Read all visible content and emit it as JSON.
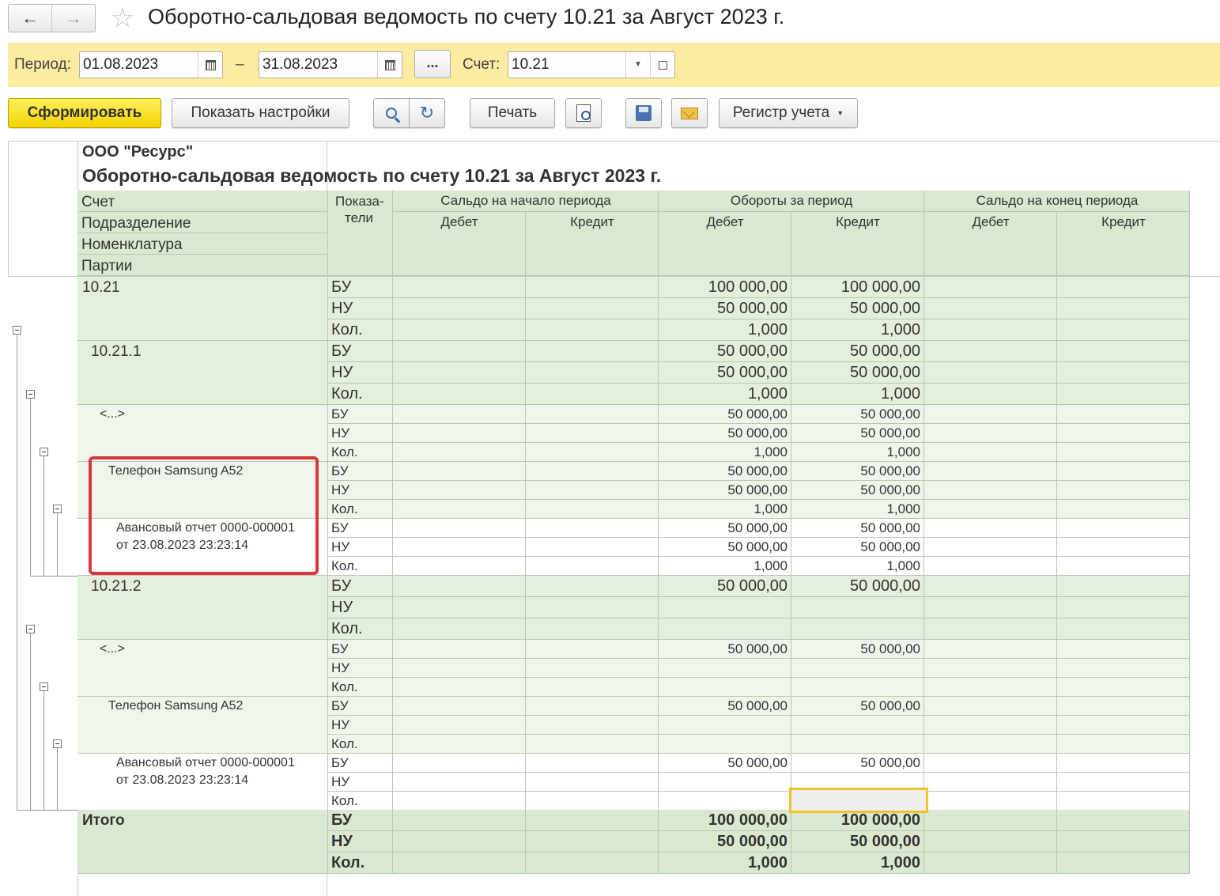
{
  "window": {
    "back_icon": "arrow-left-icon",
    "forward_icon": "arrow-right-icon",
    "favorite_icon": "star-icon",
    "title": "Оборотно-сальдовая ведомость по счету 10.21 за Август 2023 г."
  },
  "params": {
    "period_label": "Период:",
    "date_from": "01.08.2023",
    "dash": "–",
    "date_to": "31.08.2023",
    "more_label": "...",
    "account_label": "Счет:",
    "account_value": "10.21"
  },
  "toolbar": {
    "generate": "Сформировать",
    "settings": "Показать настройки",
    "print": "Печать",
    "register": "Регистр учета"
  },
  "report": {
    "org": "ООО \"Ресурс\"",
    "title": "Оборотно-сальдовая ведомость по счету 10.21 за Август 2023 г.",
    "row_headers": [
      "Счет",
      "Подразделение",
      "Номенклатура",
      "Партии"
    ],
    "indicators_header_1": "Показа-",
    "indicators_header_2": "тели",
    "groups": [
      "Сальдо на начало периода",
      "Обороты за период",
      "Сальдо на конец периода"
    ],
    "subcols": [
      "Дебет",
      "Кредит",
      "Дебет",
      "Кредит",
      "Дебет",
      "Кредит"
    ],
    "indicators": [
      "БУ",
      "НУ",
      "Кол."
    ],
    "blocks": [
      {
        "label": [
          "10.21"
        ],
        "values": [
          [
            "100 000,00",
            "100 000,00"
          ],
          [
            "50 000,00",
            "50 000,00"
          ],
          [
            "1,000",
            "1,000"
          ]
        ]
      },
      {
        "label": [
          "10.21.1"
        ],
        "values": [
          [
            "50 000,00",
            "50 000,00"
          ],
          [
            "50 000,00",
            "50 000,00"
          ],
          [
            "1,000",
            "1,000"
          ]
        ]
      },
      {
        "label": [
          "<...>"
        ],
        "values": [
          [
            "50 000,00",
            "50 000,00"
          ],
          [
            "50 000,00",
            "50 000,00"
          ],
          [
            "1,000",
            "1,000"
          ]
        ]
      },
      {
        "label": [
          "Телефон Samsung A52"
        ],
        "values": [
          [
            "50 000,00",
            "50 000,00"
          ],
          [
            "50 000,00",
            "50 000,00"
          ],
          [
            "1,000",
            "1,000"
          ]
        ]
      },
      {
        "label": [
          "Авансовый отчет 0000-000001",
          "от 23.08.2023 23:23:14"
        ],
        "values": [
          [
            "50 000,00",
            "50 000,00"
          ],
          [
            "50 000,00",
            "50 000,00"
          ],
          [
            "1,000",
            "1,000"
          ]
        ]
      },
      {
        "label": [
          "10.21.2"
        ],
        "values": [
          [
            "50 000,00",
            "50 000,00"
          ],
          [
            "",
            ""
          ],
          [
            "",
            ""
          ]
        ]
      },
      {
        "label": [
          "<...>"
        ],
        "values": [
          [
            "50 000,00",
            "50 000,00"
          ],
          [
            "",
            ""
          ],
          [
            "",
            ""
          ]
        ]
      },
      {
        "label": [
          "Телефон Samsung A52"
        ],
        "values": [
          [
            "50 000,00",
            "50 000,00"
          ],
          [
            "",
            ""
          ],
          [
            "",
            ""
          ]
        ]
      },
      {
        "label": [
          "Авансовый отчет 0000-000001",
          "от 23.08.2023 23:23:14"
        ],
        "values": [
          [
            "50 000,00",
            "50 000,00"
          ],
          [
            "",
            ""
          ],
          [
            "",
            ""
          ]
        ]
      },
      {
        "label": [
          "Итого"
        ],
        "values": [
          [
            "100 000,00",
            "100 000,00"
          ],
          [
            "50 000,00",
            "50 000,00"
          ],
          [
            "1,000",
            "1,000"
          ]
        ]
      }
    ]
  },
  "colors": {
    "accent_yellow": "#f2d400",
    "panel_yellow": "#fbeca1",
    "header_green": "#d9e8cf",
    "level1_green": "#e3eedb",
    "level2_green": "#eef5ea",
    "highlight_red": "#d9363e",
    "selection_gold": "#f2c12e"
  }
}
